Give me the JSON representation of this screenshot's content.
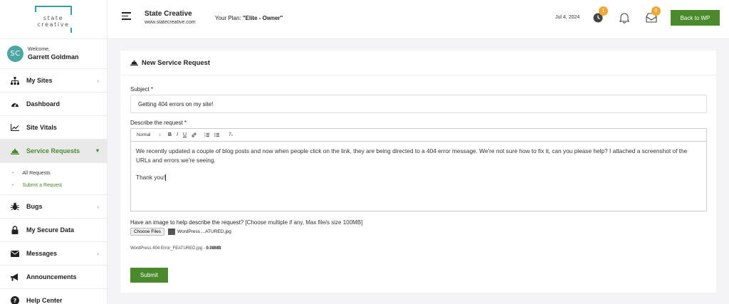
{
  "logo": {
    "line1": "state",
    "line2": "creative"
  },
  "user": {
    "initials": "SC",
    "welcome": "Welcome,",
    "name": "Garrett Goldman"
  },
  "sidebar": {
    "items": [
      {
        "label": "My Sites",
        "icon": "sitemap-icon"
      },
      {
        "label": "Dashboard",
        "icon": "dashboard-icon"
      },
      {
        "label": "Site Vitals",
        "icon": "chart-line-icon"
      },
      {
        "label": "Service Requests",
        "icon": "bell-service-icon"
      },
      {
        "label": "Bugs",
        "icon": "bug-icon"
      },
      {
        "label": "My Secure Data",
        "icon": "lock-icon"
      },
      {
        "label": "Messages",
        "icon": "envelope-icon"
      },
      {
        "label": "Announcements",
        "icon": "megaphone-icon"
      },
      {
        "label": "Help Center",
        "icon": "question-circle-icon"
      }
    ],
    "sub_items": [
      {
        "label": "All Requests"
      },
      {
        "label": "Submit a Request"
      }
    ]
  },
  "header": {
    "company": "State Creative",
    "url": "www.statecreative.com",
    "plan_prefix": "Your Plan: ",
    "plan_name": "\"Elite - Owner\"",
    "date": "Jul 4, 2024",
    "clock_badge": "1",
    "mail_badge": "0",
    "back_button": "Back to WP"
  },
  "form": {
    "title": "New Service Request",
    "subject_label": "Subject *",
    "subject_value": "Getting 404 errors on my site!",
    "describe_label": "Describe the request *",
    "toolbar": {
      "format": "Normal"
    },
    "body_p1": "We recently updated a couple of blog posts and now when people click on the link, they are being directed to a 404 error message. We're not sure how to fix it, can you please help? I attached a screenshot of the URLs and errors we're seeing.",
    "body_p2": "Thank you!",
    "image_label": "Have an image to help describe the request?",
    "image_hint": " [Choose multiple if any, Max file/s size 100MB]",
    "choose_files": "Choose Files",
    "chosen_file": "WordPress ...ATURED.jpg",
    "file_name": "WordPress 404 Error_FEATURED.jpg - ",
    "file_size": "0.08MB",
    "submit": "Submit"
  },
  "colors": {
    "accent": "#4b8a2c",
    "badge": "#f5a733",
    "logo": "#33a1a3"
  }
}
